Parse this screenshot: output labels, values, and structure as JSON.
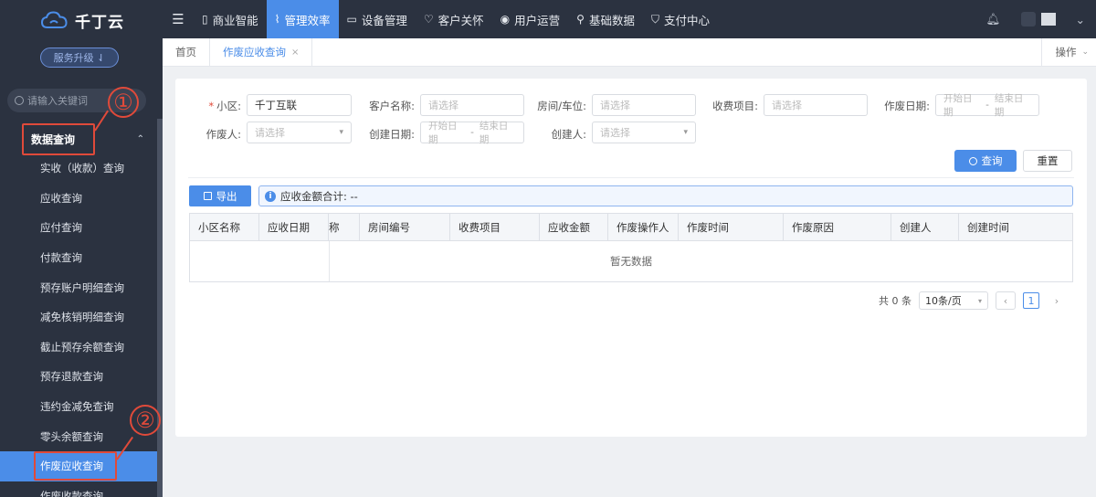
{
  "brand": {
    "name": "千丁云"
  },
  "sidebar": {
    "upgrade_label": "服务升级 ⇃",
    "search_placeholder": "请输入关键词",
    "group_label": "数据查询",
    "items": [
      {
        "label": "实收（收款）查询"
      },
      {
        "label": "应收查询"
      },
      {
        "label": "应付查询"
      },
      {
        "label": "付款查询"
      },
      {
        "label": "预存账户明细查询"
      },
      {
        "label": "减免核销明细查询"
      },
      {
        "label": "截止预存余额查询"
      },
      {
        "label": "预存退款查询"
      },
      {
        "label": "违约金减免查询"
      },
      {
        "label": "零头余额查询"
      },
      {
        "label": "作废应收查询"
      },
      {
        "label": "作废收款查询"
      }
    ],
    "active_index": 10
  },
  "annotations": {
    "one": "①",
    "two": "②"
  },
  "topnav": {
    "items": [
      {
        "label": "商业智能",
        "icon": "building-icon"
      },
      {
        "label": "管理效率",
        "icon": "chart-icon"
      },
      {
        "label": "设备管理",
        "icon": "device-icon"
      },
      {
        "label": "客户关怀",
        "icon": "heart-icon"
      },
      {
        "label": "用户运营",
        "icon": "user-icon"
      },
      {
        "label": "基础数据",
        "icon": "wrench-icon"
      },
      {
        "label": "支付中心",
        "icon": "shield-icon"
      }
    ],
    "active_index": 1
  },
  "tabs": {
    "home": "首页",
    "current": "作废应收查询",
    "close": "×",
    "ops": "操作"
  },
  "filters": {
    "community_label": "小区:",
    "community_value": "千丁互联",
    "customer_label": "客户名称:",
    "customer_placeholder": "请选择",
    "room_label": "房间/车位:",
    "room_placeholder": "请选择",
    "fee_label": "收费项目:",
    "fee_placeholder": "请选择",
    "void_date_label": "作废日期:",
    "voider_label": "作废人:",
    "voider_placeholder": "请选择",
    "create_date_label": "创建日期:",
    "creator_label": "创建人:",
    "creator_placeholder": "请选择",
    "date_start": "开始日期",
    "date_sep": "-",
    "date_end": "结束日期"
  },
  "actions": {
    "query": "查询",
    "reset": "重置",
    "export": "导出",
    "summary": "应收金额合计: --"
  },
  "table": {
    "columns": [
      "小区名称",
      "应收日期",
      "称",
      "房间编号",
      "收费项目",
      "应收金额",
      "作废操作人",
      "作废时间",
      "作废原因",
      "创建人",
      "创建时间"
    ],
    "empty_text": "暂无数据"
  },
  "pager": {
    "total": "共 0 条",
    "size": "10条/页",
    "page": "1",
    "prev": "‹",
    "next": "›"
  },
  "colors": {
    "accent": "#4b8de8",
    "sidebar": "#2b3240",
    "annotation": "#e04a3a"
  }
}
